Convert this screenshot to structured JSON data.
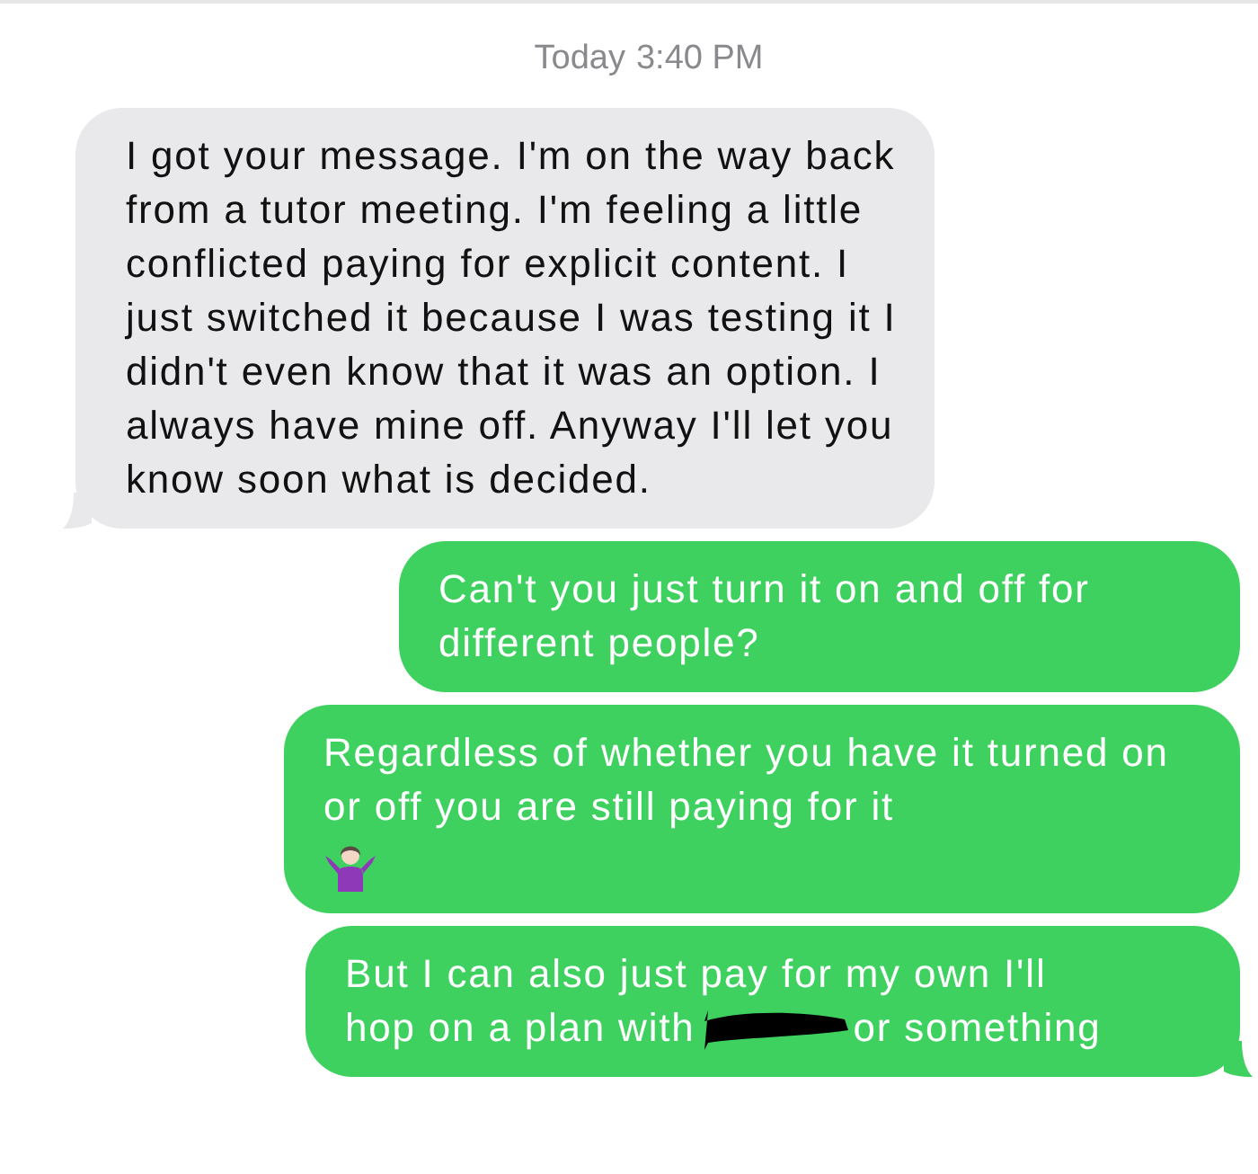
{
  "timestamp": {
    "day": "Today",
    "time": "3:40 PM"
  },
  "messages": [
    {
      "kind": "received",
      "segments": [
        {
          "kind": "text",
          "text": "I got your message. I'm on the way back from a tutor meeting.  I'm feeling a little conflicted paying for explicit content. I just switched it because I was testing it I didn't even know that it was an option. I always have mine off. Anyway I'll let you know soon what is decided."
        }
      ]
    },
    {
      "kind": "sent",
      "segments": [
        {
          "kind": "text",
          "text": "Can't you just turn it on and off for different people?"
        }
      ]
    },
    {
      "kind": "sent",
      "segments": [
        {
          "kind": "text",
          "text": "Regardless of whether you have it turned on or off you are still paying for it"
        },
        {
          "kind": "shrug"
        }
      ]
    },
    {
      "kind": "sent",
      "segments": [
        {
          "kind": "line",
          "text": "But I can also just pay for my own I'll"
        },
        {
          "kind": "inline",
          "text": "hop on a plan with"
        },
        {
          "kind": "redaction"
        },
        {
          "kind": "inline",
          "text": "or something"
        }
      ]
    }
  ]
}
